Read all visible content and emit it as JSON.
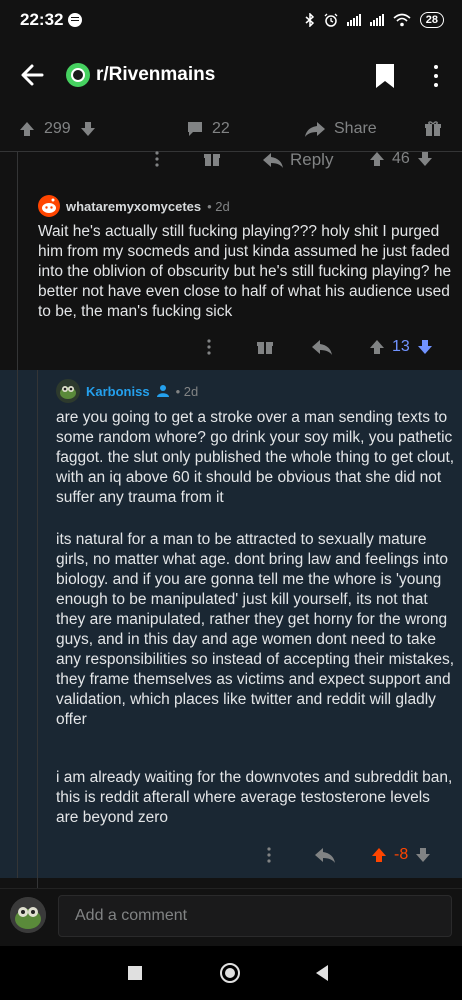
{
  "status_bar": {
    "time": "22:32",
    "battery": "28"
  },
  "header": {
    "subreddit": "r/Rivenmains"
  },
  "post_actions": {
    "score": "299",
    "comments": "22",
    "share_label": "Share"
  },
  "parent_row": {
    "reply_label": "Reply",
    "score": "46"
  },
  "comment1": {
    "username": "whataremyxomycetes",
    "age": "• 2d",
    "body": "Wait he's actually still fucking playing??? holy shit I purged him from my socmeds and just kinda assumed he just faded into the oblivion of obscurity but he's still fucking playing? he better not have even close to half of what his audience used to be, the man's fucking sick",
    "score": "13"
  },
  "comment2": {
    "username": "Karboniss",
    "age": "• 2d",
    "paragraphs": [
      "are you going to get a stroke over a man sending texts to some random whore? go drink your soy milk, you pathetic faggot. the slut only published the whole thing to get clout, with an iq above 60 it should be obvious that she did not suffer any trauma from it",
      "its natural for a man to be attracted to sexually mature girls, no matter what age. dont bring law and feelings into biology. and if you are gonna tell me the whore is 'young enough to be manipulated' just kill yourself, its not that they are manipulated, rather they get horny for the wrong guys, and in this day and age women dont need to take any responsibilities so instead of accepting their mistakes, they frame themselves as victims and expect support and validation, which places like twitter and reddit will gladly offer",
      "i am already waiting for the downvotes and subreddit ban, this is reddit afterall where average testosterone levels are beyond zero"
    ],
    "score": "-8"
  },
  "compose": {
    "placeholder": "Add a comment"
  },
  "colors": {
    "upvote_active": "#ff4500",
    "downvote_active": "#7193ff",
    "username_blue": "#24a0ed",
    "highlight_bg": "#1a2733"
  }
}
